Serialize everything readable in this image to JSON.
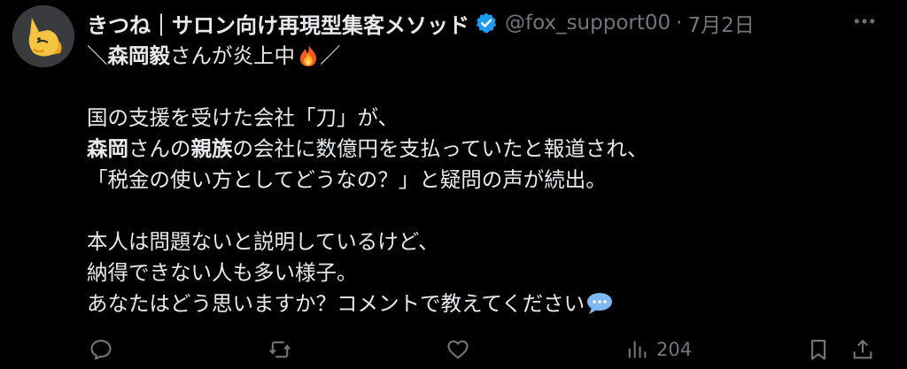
{
  "author": {
    "display_name": "きつね｜サロン向け再現型集客メソッド",
    "handle": "@fox_support00",
    "separator": "·",
    "date": "7月2日",
    "avatar_icon": "fox-avatar-icon",
    "verified_icon": "verified-badge-icon",
    "verified_color": "#1d9bf0"
  },
  "tweet": {
    "line1_a": "＼",
    "line1_b": "森岡毅",
    "line1_c": "さんが炎上中",
    "line1_d": "／",
    "line2": "国の支援を受けた会社「刀」が、",
    "line3_a": "森岡",
    "line3_b": "さんの",
    "line3_c": "親族",
    "line3_d": "の会社に数億円を支払っていたと報道され、",
    "line4": "「税金の使い方としてどうなの？」と疑問の声が続出。",
    "line5": "本人は問題ないと説明しているけど、",
    "line6": "納得できない人も多い様子。",
    "line7": "あなたはどう思いますか？コメントで教えてください",
    "fire_icon": "fire-emoji-icon",
    "speech_icon": "speech-bubble-emoji-icon"
  },
  "actions": {
    "views_count": "204",
    "reply_icon": "reply-icon",
    "retweet_icon": "retweet-icon",
    "like_icon": "heart-icon",
    "views_icon": "views-icon",
    "bookmark_icon": "bookmark-icon",
    "share_icon": "share-icon",
    "icon_color": "#71767b"
  },
  "colors": {
    "background": "#000000",
    "text_primary": "#e7e9ea",
    "text_secondary": "#71767b"
  }
}
